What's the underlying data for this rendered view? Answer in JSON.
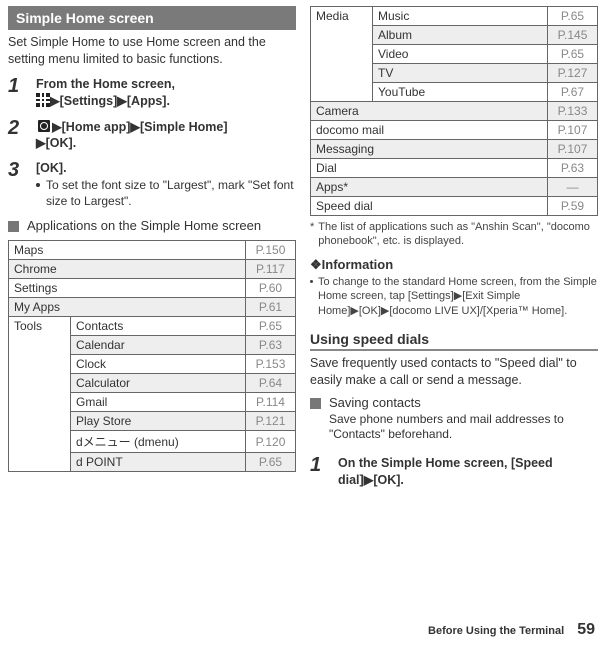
{
  "left": {
    "banner": "Simple Home screen",
    "intro": "Set Simple Home to use Home screen and the setting menu limited to basic functions.",
    "step1_label": "1",
    "step1_a": "From the Home screen, ",
    "step1_arrow1": "▶",
    "step1_b": "[Settings]",
    "step1_arrow2": "▶",
    "step1_c": "[Apps].",
    "step2_label": "2",
    "step2_arrow1": "▶",
    "step2_a": "[Home app]",
    "step2_arrow2": "▶",
    "step2_b": "[Simple Home]",
    "step2_arrow3": "▶",
    "step2_c": "[OK].",
    "step3_label": "3",
    "step3_a": "[OK].",
    "step3_note": "To set the font size to \"Largest\", mark \"Set font size to Largest\".",
    "apps_heading": "Applications on the Simple Home screen",
    "table": {
      "rows_simple": [
        {
          "name": "Maps",
          "pg": "P.150",
          "shade": false
        },
        {
          "name": "Chrome",
          "pg": "P.117",
          "shade": true
        },
        {
          "name": "Settings",
          "pg": "P.60",
          "shade": false
        },
        {
          "name": "My Apps",
          "pg": "P.61",
          "shade": true
        }
      ],
      "tools_label": "Tools",
      "tools_rows": [
        {
          "name": "Contacts",
          "pg": "P.65",
          "shade": false
        },
        {
          "name": "Calendar",
          "pg": "P.63",
          "shade": true
        },
        {
          "name": "Clock",
          "pg": "P.153",
          "shade": false
        },
        {
          "name": "Calculator",
          "pg": "P.64",
          "shade": true
        },
        {
          "name": "Gmail",
          "pg": "P.114",
          "shade": false
        },
        {
          "name": "Play Store",
          "pg": "P.121",
          "shade": true
        },
        {
          "name": "dメニュー (dmenu)",
          "pg": "P.120",
          "shade": false
        },
        {
          "name": "d POINT",
          "pg": "P.65",
          "shade": true
        }
      ]
    }
  },
  "right": {
    "table": {
      "media_label": "Media",
      "media_rows": [
        {
          "name": "Music",
          "pg": "P.65",
          "shade": false
        },
        {
          "name": "Album",
          "pg": "P.145",
          "shade": true
        },
        {
          "name": "Video",
          "pg": "P.65",
          "shade": false
        },
        {
          "name": "TV",
          "pg": "P.127",
          "shade": true
        },
        {
          "name": "YouTube",
          "pg": "P.67",
          "shade": false
        }
      ],
      "rows_after": [
        {
          "name": "Camera",
          "pg": "P.133",
          "shade": true
        },
        {
          "name": "docomo mail",
          "pg": "P.107",
          "shade": false
        },
        {
          "name": "Messaging",
          "pg": "P.107",
          "shade": true
        },
        {
          "name": "Dial",
          "pg": "P.63",
          "shade": false
        },
        {
          "name": "Apps*",
          "pg": "―",
          "shade": true
        },
        {
          "name": "Speed dial",
          "pg": "P.59",
          "shade": false
        }
      ]
    },
    "footnote": "The list of applications such as \"Anshin Scan\", \"docomo phonebook\", etc. is displayed.",
    "info_header": "Information",
    "info_a": "To change to the standard Home screen, from the Simple Home screen, tap [Settings]",
    "info_ar1": "▶",
    "info_b": "[Exit Simple Home]",
    "info_ar2": "▶",
    "info_c": "[OK]",
    "info_ar3": "▶",
    "info_d": "[docomo LIVE UX]/[Xperia™ Home].",
    "speed_banner": "Using speed dials",
    "speed_intro": "Save frequently used contacts to \"Speed dial\" to easily make a call or send a message.",
    "saving_head": "Saving contacts",
    "saving_body": "Save phone numbers and mail addresses to \"Contacts\" beforehand.",
    "sstep1_label": "1",
    "sstep1_a": "On the Simple Home screen, [Speed dial]",
    "sstep1_arrow": "▶",
    "sstep1_b": "[OK]."
  },
  "footer": {
    "section": "Before Using the Terminal",
    "page": "59"
  }
}
